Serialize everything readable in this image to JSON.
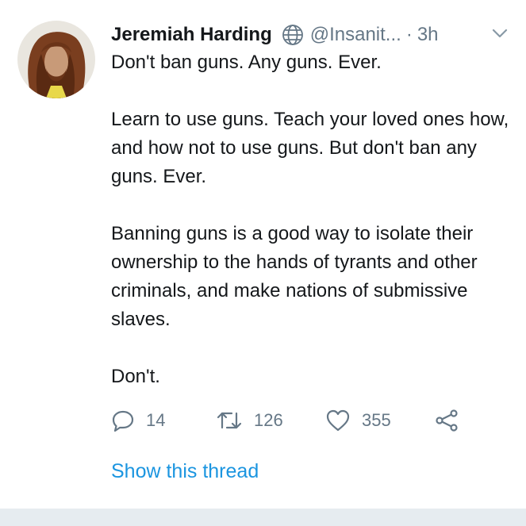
{
  "tweet": {
    "author_name": "Jeremiah Harding",
    "handle": "@Insanit...",
    "separator": "·",
    "time": "3h",
    "paragraphs": [
      "Don't ban guns. Any guns. Ever.",
      "Learn to use guns. Teach your loved ones how, and how not to use guns. But don't ban any guns. Ever.",
      "Banning guns is a good way to isolate their ownership to the hands of tyrants and other criminals, and make nations of submissive slaves.",
      "Don't."
    ],
    "actions": {
      "reply_count": "14",
      "retweet_count": "126",
      "like_count": "355"
    },
    "show_thread_label": "Show this thread"
  },
  "icons": {
    "author_badge": "globe-icon",
    "menu": "chevron-down-icon",
    "reply": "reply-icon",
    "retweet": "retweet-icon",
    "like": "heart-icon",
    "share": "share-icon"
  },
  "colors": {
    "text": "#14171a",
    "muted": "#657786",
    "link": "#1b95e0",
    "divider": "#e6ecf0"
  }
}
